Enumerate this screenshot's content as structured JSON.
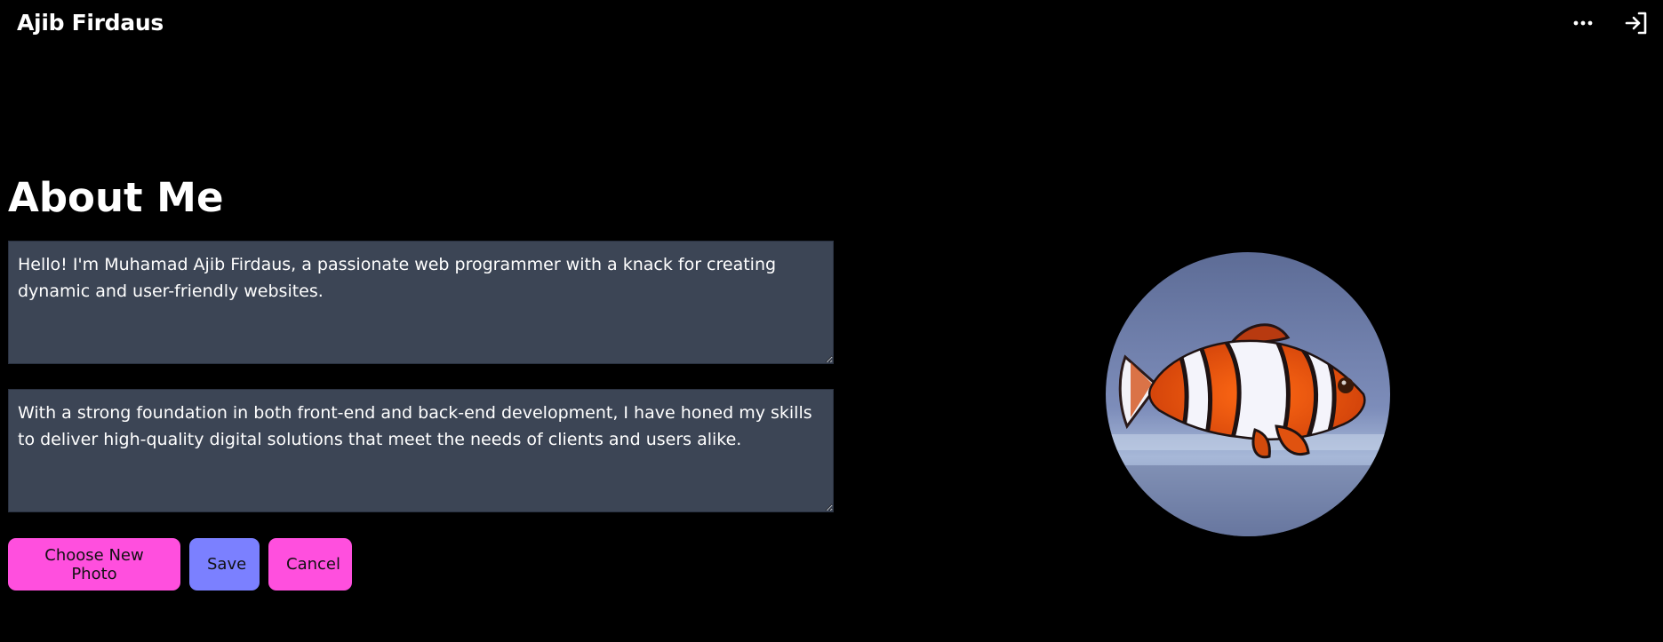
{
  "header": {
    "site_title": "Ajib Firdaus",
    "more_icon": "more-horizontal-icon",
    "login_icon": "sign-in-icon"
  },
  "about": {
    "heading": "About Me",
    "paragraph_1": "Hello! I'm Muhamad Ajib Firdaus, a passionate web programmer with a knack for creating dynamic and user-friendly websites.",
    "paragraph_2": "With a strong foundation in both front-end and back-end development, I have honed my skills to deliver high-quality digital solutions that meet the needs of clients and users alike."
  },
  "actions": {
    "choose_photo_label": "Choose New Photo",
    "save_label": "Save",
    "cancel_label": "Cancel"
  },
  "photo": {
    "subject": "clownfish"
  },
  "colors": {
    "background": "#000000",
    "textarea_bg": "#3c4555",
    "pink_button": "#ff4fde",
    "blue_button": "#7b80ff"
  }
}
